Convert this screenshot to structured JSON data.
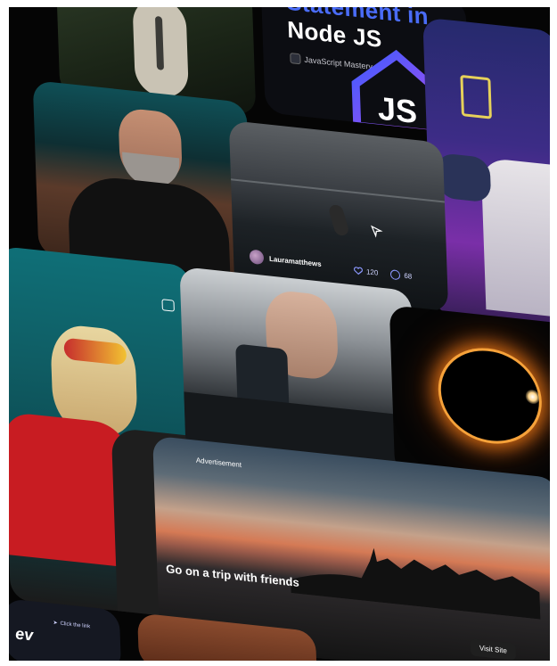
{
  "cards": {
    "js_course": {
      "title_line1": "Statement in",
      "title_line2": "Node JS",
      "channel": "JavaScript Mastery",
      "logo_text": "JS"
    },
    "ocean_post": {
      "author": "Lauramatthews",
      "likes": "120",
      "comments": "68"
    },
    "advertisement": {
      "label": "Advertisement",
      "headline": "Go on a trip with friends",
      "cta": "Visit Site"
    },
    "dev_card": {
      "code_text": "ev",
      "hint": "Click the link"
    }
  },
  "icons": {
    "heart": "heart-icon",
    "comment": "comment-icon",
    "camera": "camera-icon",
    "cursor": "cursor-icon"
  },
  "colors": {
    "accent": "#4a6cf7",
    "eclipse_ring": "#f6a23a"
  }
}
